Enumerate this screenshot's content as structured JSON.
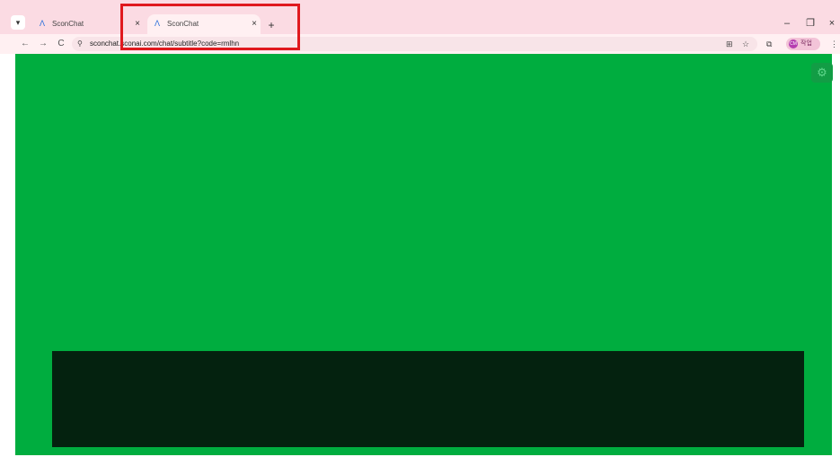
{
  "browser": {
    "tabs": [
      {
        "title": "SconChat",
        "favicon": "a-logo-icon",
        "active": false
      },
      {
        "title": "SconChat",
        "favicon": "a-logo-icon",
        "active": true
      }
    ],
    "new_tab_symbol": "+",
    "tab_close_symbol": "×",
    "tab_dropdown_symbol": "▾",
    "window_controls": {
      "minimize": "–",
      "restore": "❐",
      "close": "×"
    },
    "nav": {
      "back": "←",
      "forward": "→",
      "reload": "C"
    },
    "address": {
      "url": "sconchat.sconai.com/chat/subtitle?code=rmlhn",
      "site_info_icon": "⚲"
    },
    "toolbar_icons": {
      "translate": "⊞",
      "bookmark": "☆",
      "extensions": "⧉",
      "menu": "⋮"
    },
    "profile": {
      "label": "작업",
      "avatar_text": "CM"
    }
  },
  "page": {
    "background_color": "#00ad3f",
    "subtitle_box_color": "#04220f",
    "settings_icon": "⚙"
  },
  "annotation": {
    "highlight_color": "#e0191e"
  }
}
